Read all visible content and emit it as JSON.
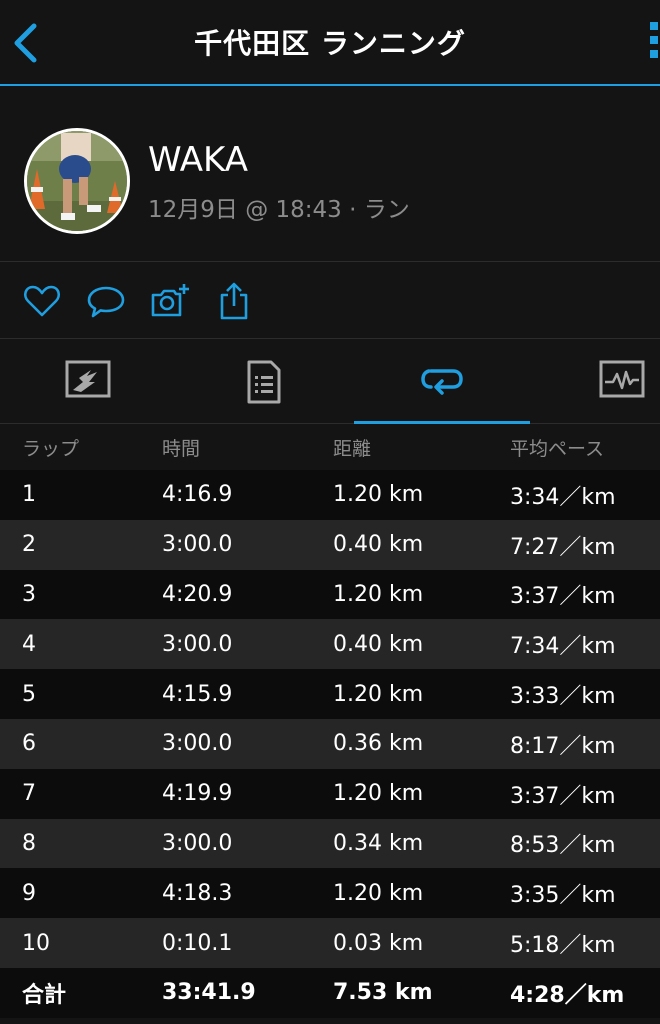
{
  "header": {
    "title": "千代田区 ランニング"
  },
  "profile": {
    "name": "WAKA",
    "meta": "12月9日 @ 18:43 · ラン"
  },
  "actions": [
    {
      "icon": "heart-icon"
    },
    {
      "icon": "comment-icon"
    },
    {
      "icon": "add-photo-icon"
    },
    {
      "icon": "share-icon"
    }
  ],
  "tabs": [
    {
      "icon": "map-icon",
      "active": false
    },
    {
      "icon": "stats-icon",
      "active": false
    },
    {
      "icon": "laps-icon",
      "active": true
    },
    {
      "icon": "chart-icon",
      "active": false
    }
  ],
  "table": {
    "columns": [
      "ラップ",
      "時間",
      "距離",
      "平均ペース"
    ],
    "rows": [
      [
        "1",
        "4:16.9",
        "1.20 km",
        "3:34／km"
      ],
      [
        "2",
        "3:00.0",
        "0.40 km",
        "7:27／km"
      ],
      [
        "3",
        "4:20.9",
        "1.20 km",
        "3:37／km"
      ],
      [
        "4",
        "3:00.0",
        "0.40 km",
        "7:34／km"
      ],
      [
        "5",
        "4:15.9",
        "1.20 km",
        "3:33／km"
      ],
      [
        "6",
        "3:00.0",
        "0.36 km",
        "8:17／km"
      ],
      [
        "7",
        "4:19.9",
        "1.20 km",
        "3:37／km"
      ],
      [
        "8",
        "3:00.0",
        "0.34 km",
        "8:53／km"
      ],
      [
        "9",
        "4:18.3",
        "1.20 km",
        "3:35／km"
      ],
      [
        "10",
        "0:10.1",
        "0.03 km",
        "5:18／km"
      ]
    ],
    "total": [
      "合計",
      "33:41.9",
      "7.53 km",
      "4:28／km"
    ]
  },
  "colors": {
    "accent": "#1f9ee0",
    "background": "#141414",
    "row_alt": "#262626",
    "muted_text": "#8c8c8c"
  }
}
